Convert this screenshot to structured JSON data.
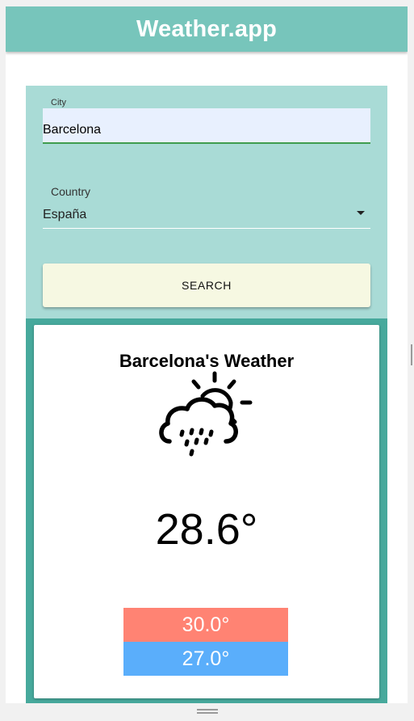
{
  "app": {
    "title": "Weather.app"
  },
  "form": {
    "city_label": "City",
    "city_value": "Barcelona",
    "country_label": "Country",
    "country_value": "España",
    "search_label": "SEARCH"
  },
  "weather": {
    "title": "Barcelona's Weather",
    "icon": "cloud-sun-rain-icon",
    "temperature": "28.6°",
    "max": "30.0°",
    "min": "27.0°"
  },
  "colors": {
    "appbar": "#77c5bb",
    "form_panel": "#a9dbd6",
    "result_panel": "#47a99c",
    "search_button": "#f6f8e2",
    "max_temp": "#ff8373",
    "min_temp": "#5aaefb"
  }
}
